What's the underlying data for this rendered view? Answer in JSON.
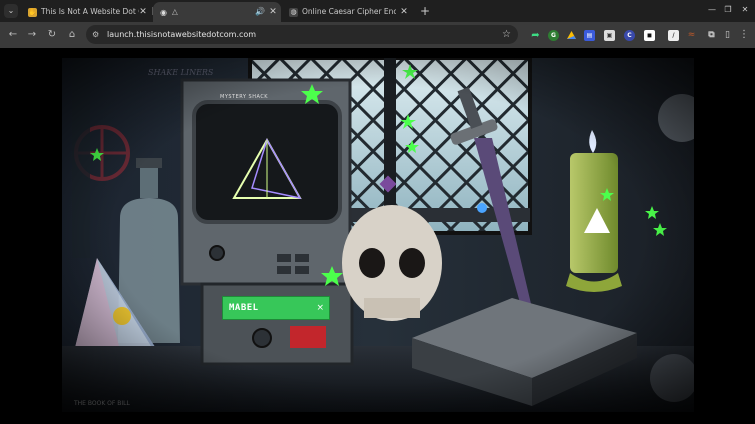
{
  "tabs": [
    {
      "title": "This Is Not A Website Dot Com",
      "icon": "gold-hand-icon",
      "active": false
    },
    {
      "title": "△",
      "icon": "eye-icon",
      "active": true
    },
    {
      "title": "Online Caesar Cipher Encode a",
      "icon": "globe-icon",
      "active": false
    }
  ],
  "toolbar": {
    "url": "launch.thisisnotawebsitedotcom.com"
  },
  "scene": {
    "name_field_value": "MABEL",
    "name_field_close": "×",
    "monitor_label": "MYSTERY SHACK",
    "wall_text": "SHAKE LINERS",
    "caption": "THE BOOK OF BILL"
  },
  "colors": {
    "tabbar": "#1f1f1f",
    "toolbar": "#3a3a3a",
    "omnibox": "#282828",
    "name_field": "#37c759",
    "accent_star": "#4cff4c"
  }
}
